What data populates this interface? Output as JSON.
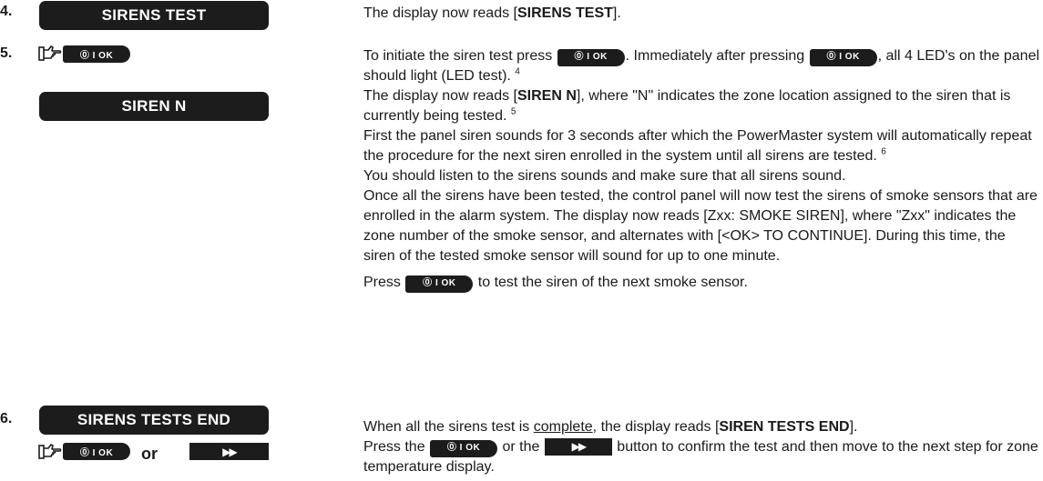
{
  "steps": [
    {
      "num": "4.",
      "lcd": "SIRENS TEST"
    },
    {
      "num": "5.",
      "lcd": "SIREN N"
    },
    {
      "num": "6.",
      "lcd": "SIRENS TESTS END"
    }
  ],
  "keys": {
    "ok_label": "⓪ I OK",
    "ff_label": "▶▶",
    "or_text": "or"
  },
  "text": {
    "s4": {
      "pre": "The display now reads [",
      "bold": "SIRENS TEST",
      "post": "]."
    },
    "s5a": {
      "pre": "To initiate the siren test press ",
      "mid": ". Immediately after pressing ",
      "post": ", all 4 LED's on the panel should light (LED test). ",
      "fn": "4"
    },
    "s5b": {
      "pre": "The display now reads [",
      "bold": "SIREN N",
      "post": "], where \"N\" indicates the zone location assigned to the siren that is currently being tested. ",
      "fn": "5"
    },
    "s5c": {
      "body": "First the panel siren sounds for 3 seconds after which the PowerMaster system will automatically repeat the procedure for the next siren enrolled in the system until all sirens are tested. ",
      "fn": "6"
    },
    "s5d": "You should listen to the sirens sounds and make sure that all sirens sound.",
    "s5e": "Once all the sirens have been tested, the control panel will now test the sirens of smoke sensors that are enrolled in the alarm system. The display now reads [Zxx: SMOKE SIREN], where \"Zxx\" indicates the zone number of the smoke sensor, and alternates with [<OK> TO CONTINUE]. During this time, the siren of the tested smoke sensor will sound for up to one minute.",
    "s5f": {
      "pre": "Press ",
      "post": " to test the siren of the next smoke sensor."
    },
    "s6a": {
      "pre": "When all the sirens test is ",
      "underlined": "complete",
      "mid": ", the display reads [",
      "bold": "SIREN TESTS END",
      "post": "]."
    },
    "s6b": {
      "pre": "Press the ",
      "mid": " or the ",
      "post": " button to confirm the test and then move to the next step for zone temperature display."
    }
  }
}
